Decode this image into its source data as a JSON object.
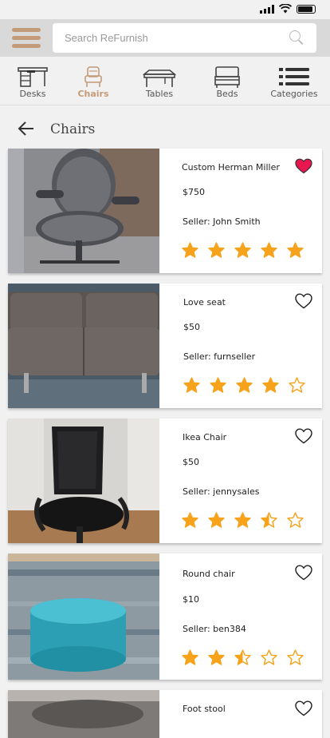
{
  "search": {
    "placeholder": "Search ReFurnish"
  },
  "categories": [
    {
      "label": "Desks",
      "icon": "desk-icon"
    },
    {
      "label": "Chairs",
      "icon": "chair-icon"
    },
    {
      "label": "Tables",
      "icon": "table-icon"
    },
    {
      "label": "Beds",
      "icon": "bed-icon"
    },
    {
      "label": "Categories",
      "icon": "list-icon"
    }
  ],
  "active_category": "Chairs",
  "page": {
    "title": "Chairs"
  },
  "listings": [
    {
      "name": "Custom Herman Miller",
      "price": "$750",
      "seller": "Seller: John Smith",
      "rating": 5,
      "favorite": true
    },
    {
      "name": "Love seat",
      "price": "$50",
      "seller": "Seller: furnseller",
      "rating": 4,
      "favorite": false
    },
    {
      "name": "Ikea Chair",
      "price": "$50",
      "seller": "Seller: jennysales",
      "rating": 3.5,
      "favorite": false
    },
    {
      "name": "Round chair",
      "price": "$10",
      "seller": "Seller: ben384",
      "rating": 2.5,
      "favorite": false
    },
    {
      "name": "Foot stool",
      "price": "",
      "seller": "",
      "rating": 0,
      "favorite": false
    }
  ],
  "colors": {
    "accent": "#c39b78",
    "star": "#f7a21b",
    "favorite": "#e8174f"
  }
}
